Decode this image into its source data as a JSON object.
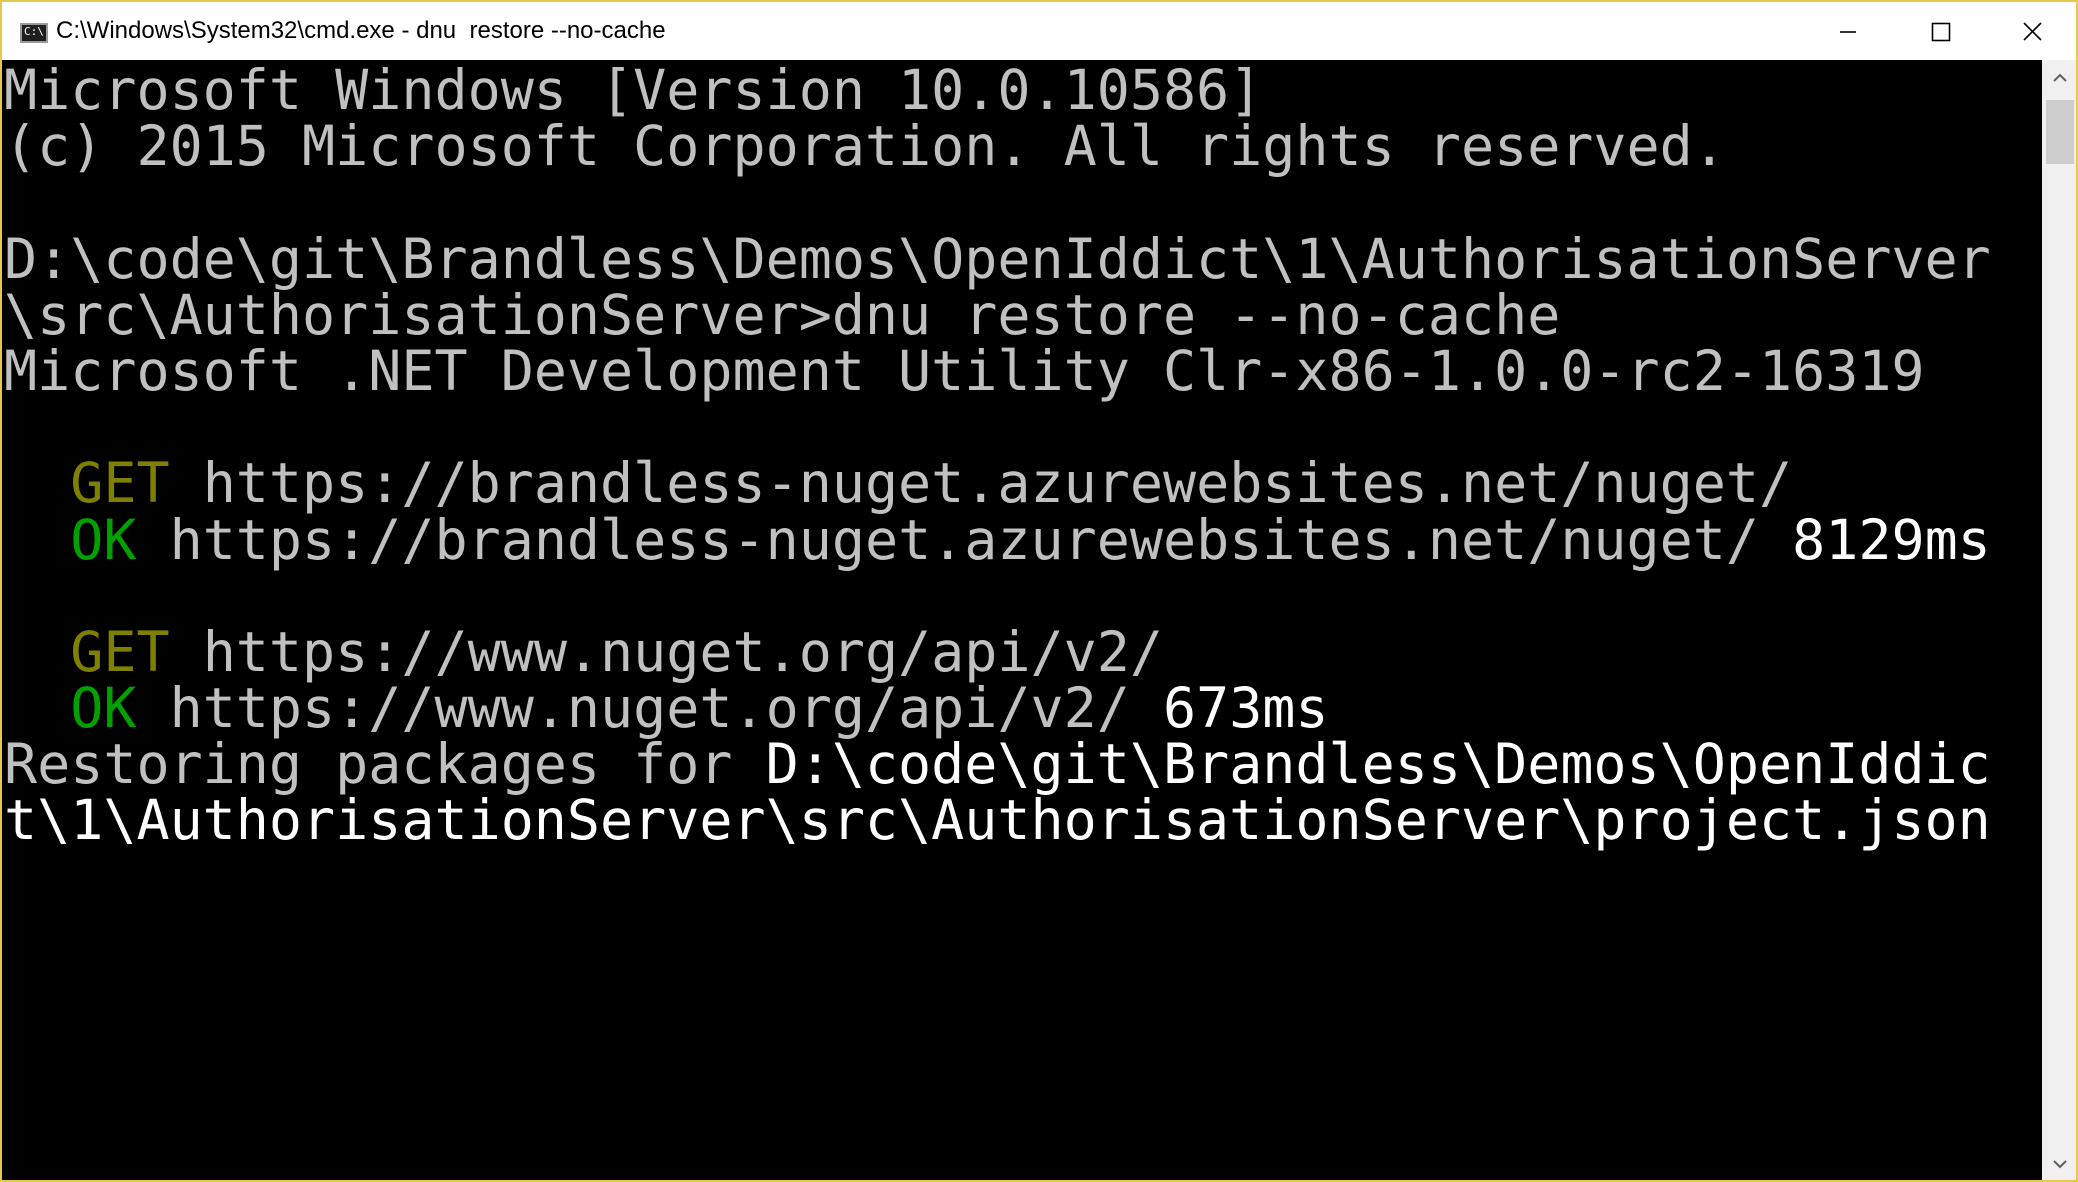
{
  "window": {
    "title": "C:\\Windows\\System32\\cmd.exe - dnu  restore --no-cache",
    "icon": "cmd-console-icon",
    "icon_glyph": "C:\\",
    "controls": {
      "minimize_icon": "minimize-icon",
      "maximize_icon": "maximize-icon",
      "close_icon": "close-icon"
    }
  },
  "colors": {
    "background": "#000000",
    "text_default": "#c0c0c0",
    "text_bright": "#ffffff",
    "get_label": "#808000",
    "ok_label": "#00a000",
    "title_border": "#e8c84a"
  },
  "console": {
    "lines": [
      [
        {
          "text": "Microsoft Windows [Version 10.0.10586]",
          "color": "gray"
        }
      ],
      [
        {
          "text": "(c) 2015 Microsoft Corporation. All rights reserved.",
          "color": "gray"
        }
      ],
      [],
      [
        {
          "text": "D:\\code\\git\\Brandless\\Demos\\OpenIddict\\1\\AuthorisationServer",
          "color": "gray"
        }
      ],
      [
        {
          "text": "\\src\\AuthorisationServer>dnu restore --no-cache",
          "color": "gray"
        }
      ],
      [
        {
          "text": "Microsoft .NET Development Utility Clr-x86-1.0.0-rc2-16319",
          "color": "gray"
        }
      ],
      [],
      [
        {
          "text": "  ",
          "color": "gray"
        },
        {
          "text": "GET",
          "color": "olive"
        },
        {
          "text": " https://brandless-nuget.azurewebsites.net/nuget/",
          "color": "gray"
        }
      ],
      [
        {
          "text": "  ",
          "color": "gray"
        },
        {
          "text": "OK",
          "color": "green"
        },
        {
          "text": " https://brandless-nuget.azurewebsites.net/nuget/",
          "color": "gray"
        },
        {
          "text": " 8129ms",
          "color": "white"
        }
      ],
      [],
      [
        {
          "text": "  ",
          "color": "gray"
        },
        {
          "text": "GET",
          "color": "olive"
        },
        {
          "text": " https://www.nuget.org/api/v2/",
          "color": "gray"
        }
      ],
      [
        {
          "text": "  ",
          "color": "gray"
        },
        {
          "text": "OK",
          "color": "green"
        },
        {
          "text": " https://www.nuget.org/api/v2/",
          "color": "gray"
        },
        {
          "text": " 673ms",
          "color": "white"
        }
      ],
      [
        {
          "text": "Restoring packages for ",
          "color": "gray"
        },
        {
          "text": "D:\\code\\git\\Brandless\\Demos\\OpenIddic",
          "color": "white"
        }
      ],
      [
        {
          "text": "t\\1\\AuthorisationServer\\src\\AuthorisationServer\\project.json",
          "color": "white"
        }
      ]
    ]
  },
  "scrollbar": {
    "up_icon": "scroll-up-arrow-icon",
    "down_icon": "scroll-down-arrow-icon"
  }
}
